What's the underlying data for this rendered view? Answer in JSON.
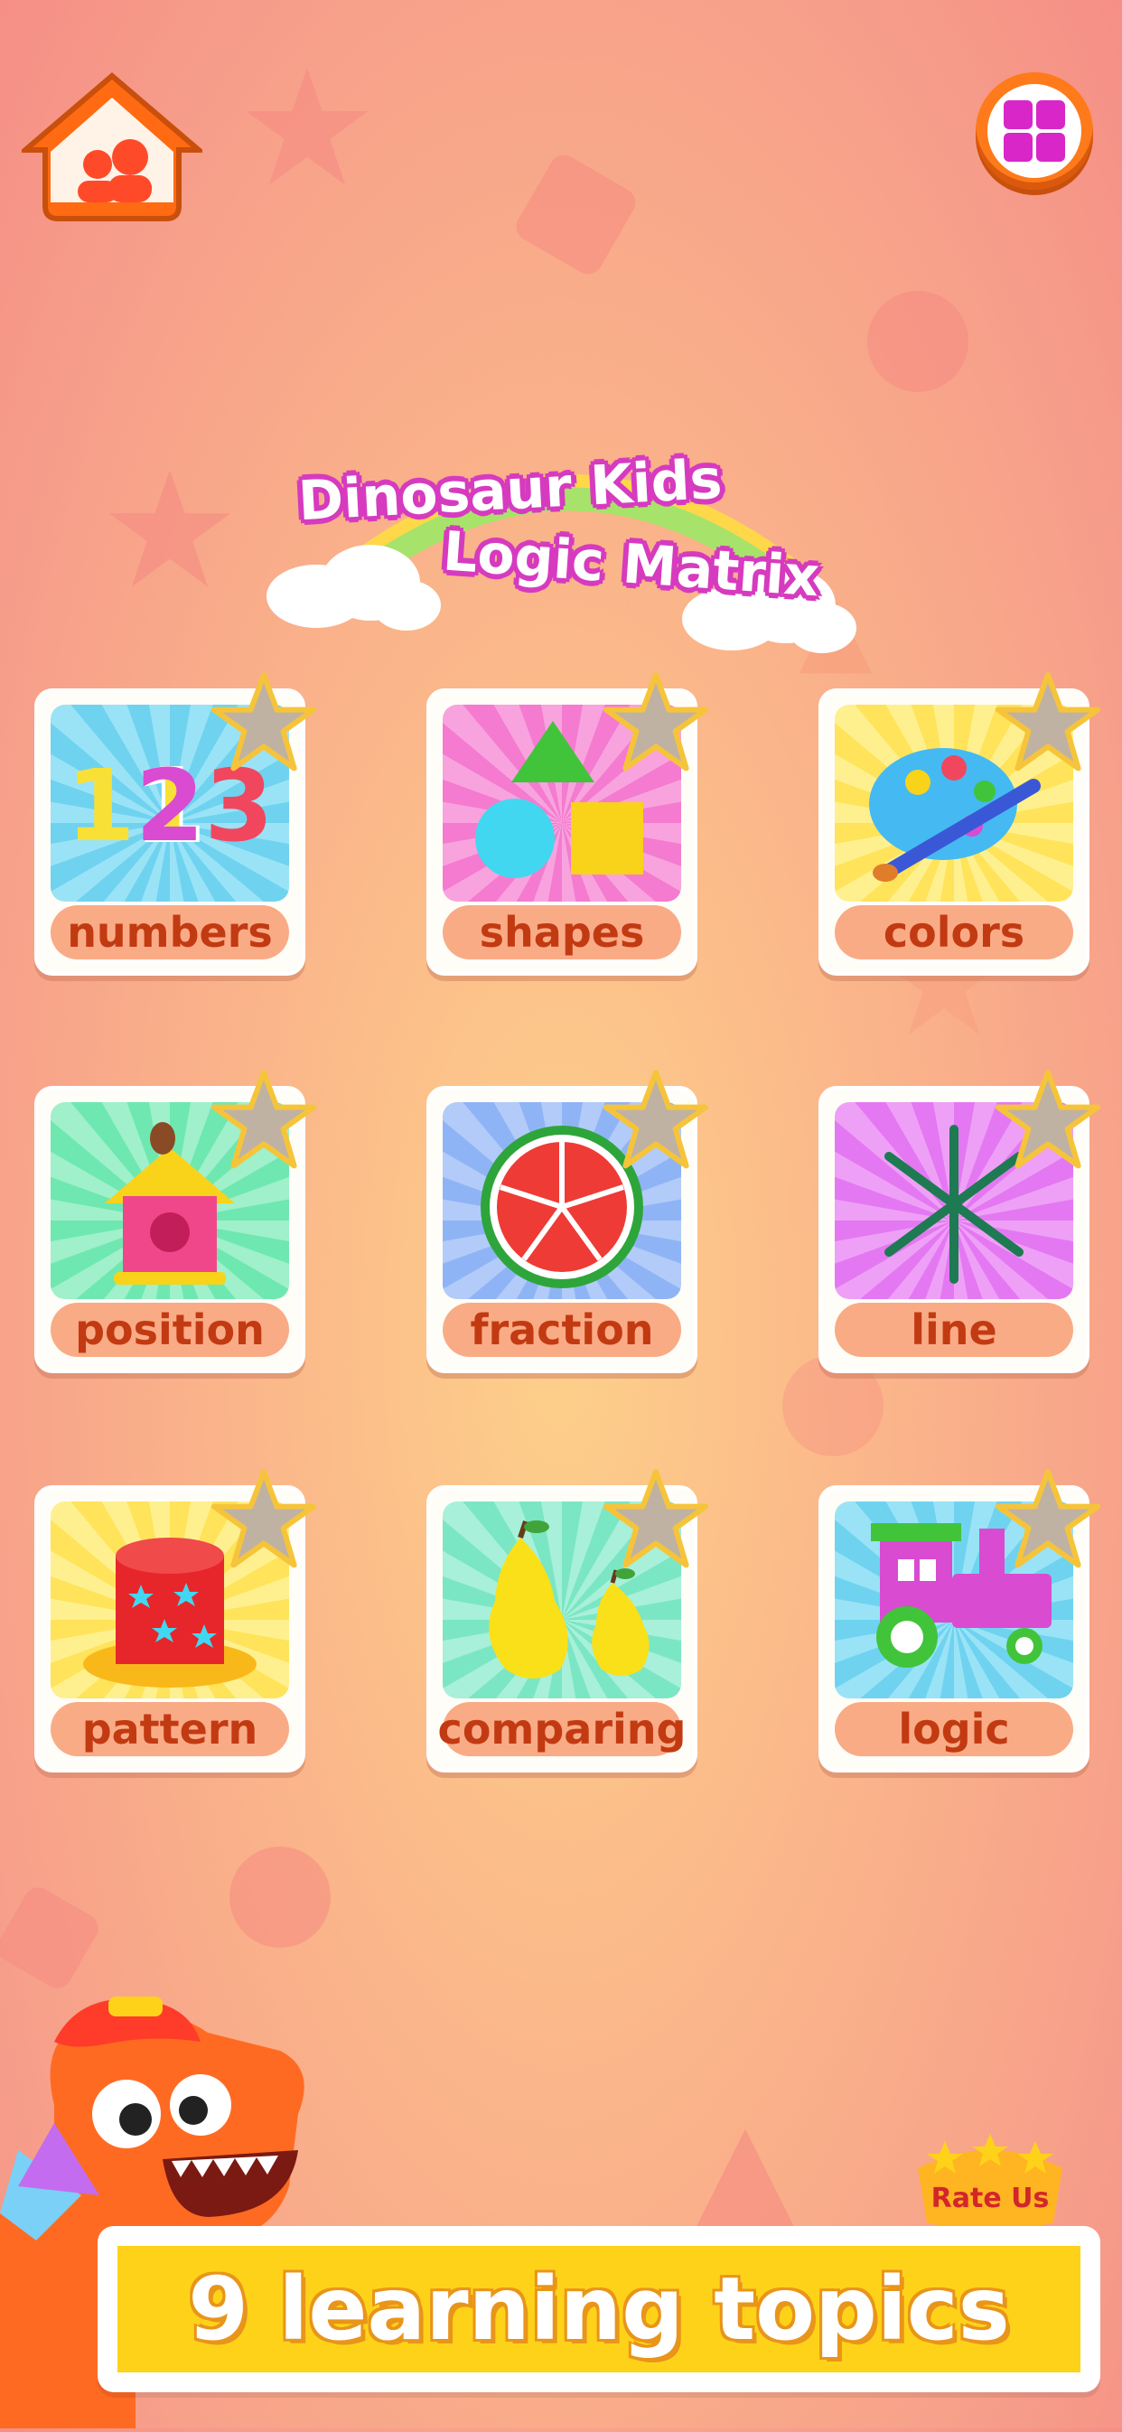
{
  "app": {
    "title_line1": "Dinosaur Kids",
    "title_line2": "Logic Matrix"
  },
  "topbar": {
    "home_icon": "family-house-icon",
    "menu_icon": "grid-menu-icon"
  },
  "topics": [
    {
      "label": "numbers",
      "icon": "numbers-123-icon",
      "bg": "#6fd3f0"
    },
    {
      "label": "shapes",
      "icon": "shapes-icon",
      "bg": "#f47bd0"
    },
    {
      "label": "colors",
      "icon": "palette-icon",
      "bg": "#ffe35a"
    },
    {
      "label": "position",
      "icon": "birdhouse-icon",
      "bg": "#6ee8b0"
    },
    {
      "label": "fraction",
      "icon": "watermelon-icon",
      "bg": "#8fb4f6"
    },
    {
      "label": "line",
      "icon": "asterisk-lines-icon",
      "bg": "#e478f2"
    },
    {
      "label": "pattern",
      "icon": "hat-icon",
      "bg": "#ffe35a"
    },
    {
      "label": "comparing",
      "icon": "pears-icon",
      "bg": "#7be6c4"
    },
    {
      "label": "logic",
      "icon": "train-icon",
      "bg": "#6fd3f0"
    }
  ],
  "rate_us": {
    "label": "Rate Us"
  },
  "footer": {
    "text": "9 learning topics"
  },
  "colors": {
    "accent_orange": "#ff7a1a",
    "label_text": "#c23a12",
    "banner_yellow": "#ffd21a"
  }
}
